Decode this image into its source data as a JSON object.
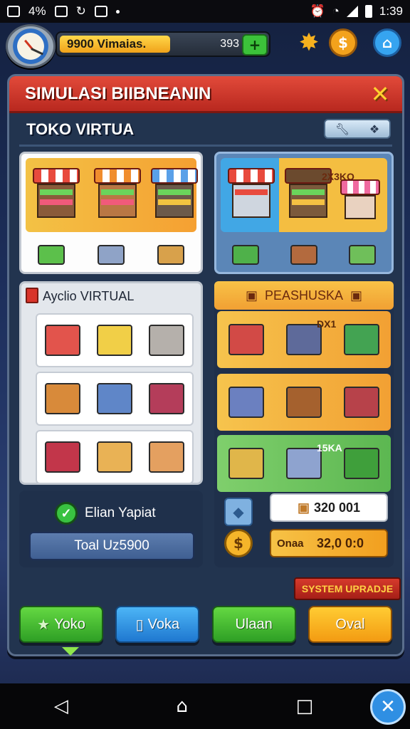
{
  "status_bar": {
    "battery_percent": "4%",
    "time": "1:39"
  },
  "hud": {
    "coins_label": "9900 Vimaias.",
    "coins_count": "393",
    "coins_fill": 0.52,
    "plus_icon": "plus-icon",
    "settings_icon": "gear-icon",
    "currency_icon": "coin-icon",
    "home_icon": "home-icon"
  },
  "panel": {
    "title": "SIMULASI BIIBNEANIN",
    "close_symbol": "✕",
    "subtitle": "TOKO VIRTUA",
    "top_right_card_label": "2X3KO",
    "section_left_title": "Ayclio VIRTUAL",
    "section_right_title": "PEASHUSKA",
    "right_row1_label": "DX1",
    "right_row3_label": "15KA",
    "verified_label": "Elian Yapiat",
    "total_label": "Toal Uz5900",
    "price_top": "320 001",
    "price_bottom_label": "Onaa",
    "price_bottom_value": "32,0 0:0",
    "system_upgrade": "SYSTEM UPRADJE"
  },
  "buttons": [
    {
      "label": "Yoko",
      "icon": "star-icon"
    },
    {
      "label": "Voka",
      "icon": "tablet-icon"
    },
    {
      "label": "Ulaan"
    },
    {
      "label": "Oval"
    }
  ],
  "colors": {
    "title_red": "#e24a3a",
    "accent_orange": "#f4a62a",
    "accent_green": "#3cc23a",
    "accent_blue": "#2f8fe3"
  }
}
